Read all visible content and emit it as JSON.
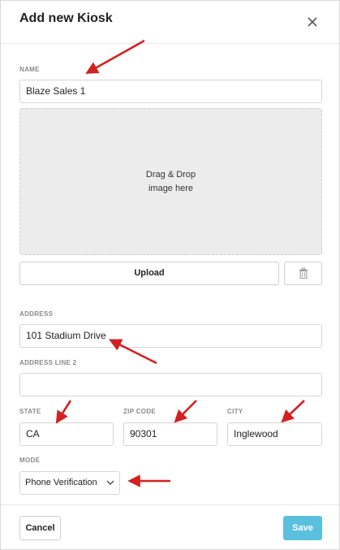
{
  "modal": {
    "title": "Add new Kiosk"
  },
  "form": {
    "name_label": "NAME",
    "name_value": "Blaze Sales 1",
    "dropzone_text": "Drag & Drop\nimage here",
    "upload_label": "Upload",
    "address_label": "ADDRESS",
    "address_value": "101 Stadium Drive",
    "address2_label": "ADDRESS LINE 2",
    "address2_value": "",
    "state_label": "STATE",
    "state_value": "CA",
    "zip_label": "ZIP CODE",
    "zip_value": "90301",
    "city_label": "CITY",
    "city_value": "Inglewood",
    "mode_label": "MODE",
    "mode_value": "Phone Verification"
  },
  "footer": {
    "cancel_label": "Cancel",
    "save_label": "Save"
  },
  "colors": {
    "save_button": "#5bc0de",
    "annotation_arrow": "#d32020"
  },
  "icons": {
    "close": "close-icon",
    "delete": "trash-icon",
    "dropdown": "chevron-down-icon"
  }
}
